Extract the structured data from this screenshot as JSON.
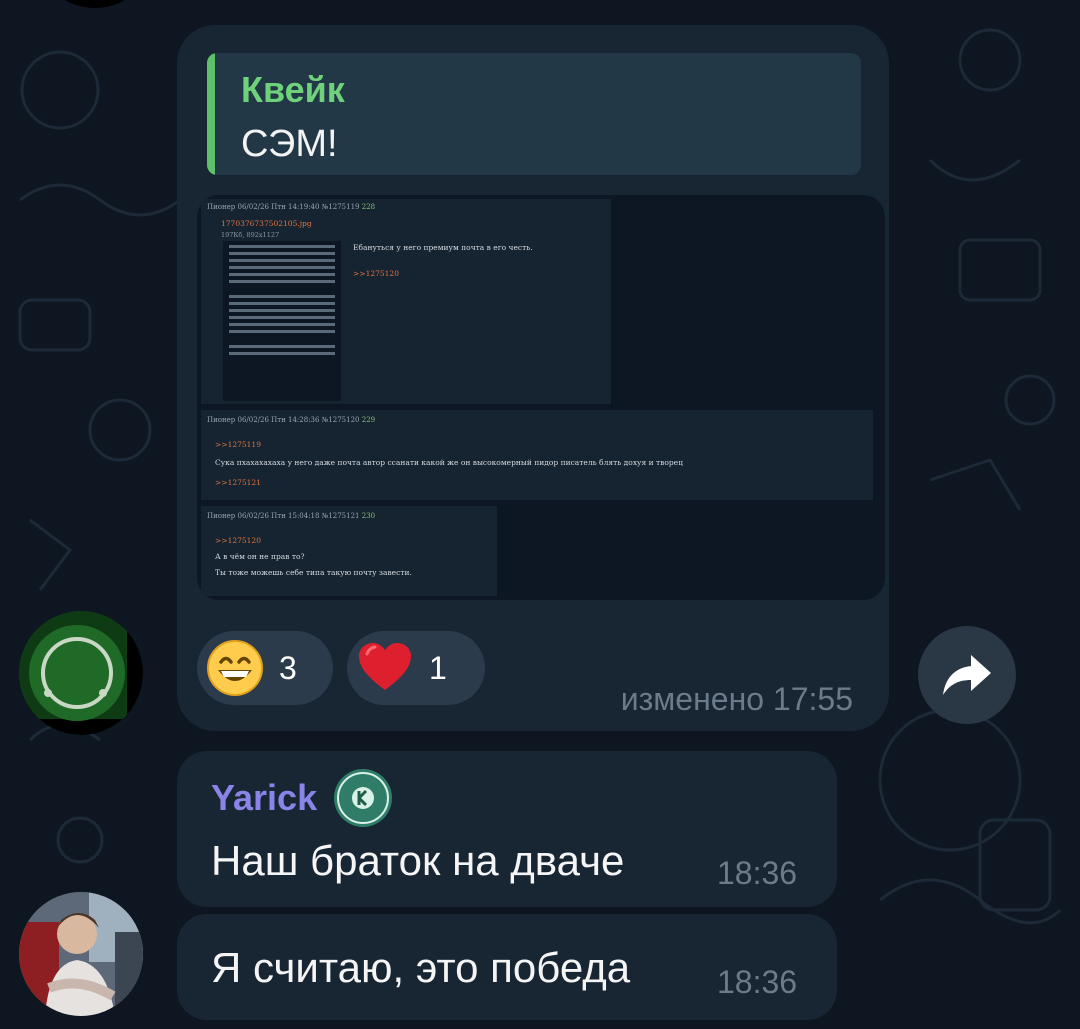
{
  "quote": {
    "author": "Квейк",
    "text": "СЭМ!"
  },
  "screenshot": {
    "posts": [
      {
        "meta_prefix": "Пионер 06/02/26 Птн 14:19:40 №1275119",
        "num": "228",
        "file": "1770376737502105.jpg",
        "file_info": "197Кб, 892x1127",
        "reply_text": "Ебануться у него премиум почта в его честь.",
        "ref": ">>1275120"
      },
      {
        "meta_prefix": "Пионер 06/02/26 Птн 14:28:36 №1275120",
        "num": "229",
        "ref_top": ">>1275119",
        "text": "Сука пхахахахаха у него даже почта автор ссанати какой же он высокомерный пидор писатель блять дохуя и творец",
        "ref_bottom": ">>1275121"
      },
      {
        "meta_prefix": "Пионер 06/02/26 Птн 15:04:18 №1275121",
        "num": "230",
        "ref_top": ">>1275120",
        "line1": "А в чём он не прав то?",
        "line2": "Ты тоже можешь себе типа такую почту завести."
      }
    ]
  },
  "reactions": [
    {
      "emoji": "grinning-face",
      "count": "3"
    },
    {
      "emoji": "red-heart",
      "count": "1"
    }
  ],
  "message1": {
    "edited_label": "изменено 17:55"
  },
  "message2": {
    "sender": "Yarick",
    "text": "Наш браток на дваче",
    "time": "18:36"
  },
  "message3": {
    "text": "Я считаю, это победа",
    "time": "18:36"
  },
  "colors": {
    "background": "#0e1621",
    "bubble": "#182533",
    "quote_accent": "#5fbf6a",
    "sender_name": "#8a84e8",
    "timestamp": "#6c7b8a"
  }
}
